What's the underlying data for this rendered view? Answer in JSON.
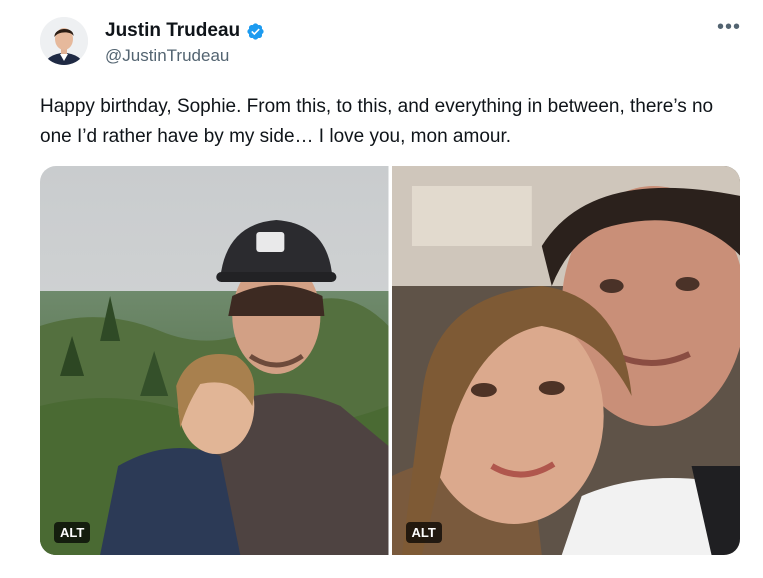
{
  "author": {
    "name": "Justin Trudeau",
    "handle": "@JustinTrudeau",
    "verified": true,
    "verified_color": "#1d9bf0"
  },
  "more_icon": "more-horizontal-icon",
  "tweet_text": "Happy birthday, Sophie. From this, to this, and everything in between, there’s no one I’d rather have by my side… I love you, mon amour.",
  "media": [
    {
      "badge": "ALT"
    },
    {
      "badge": "ALT"
    }
  ]
}
